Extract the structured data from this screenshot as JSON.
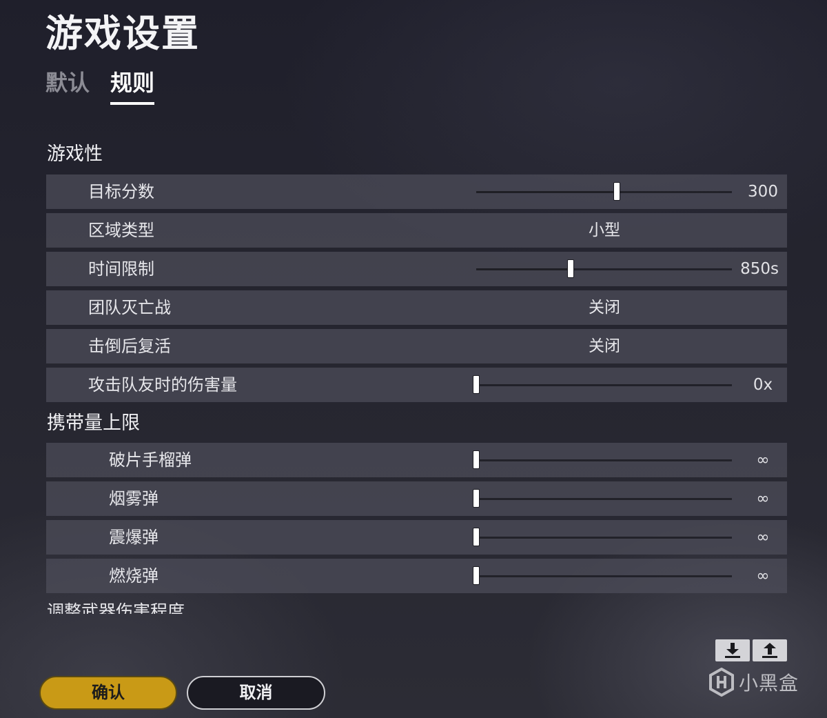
{
  "page": {
    "title": "游戏设置"
  },
  "tabs": [
    {
      "label": "默认",
      "active": false
    },
    {
      "label": "规则",
      "active": true
    }
  ],
  "gameplay": {
    "title": "游戏性",
    "rows": [
      {
        "label": "目标分数",
        "type": "slider",
        "fraction": 0.55,
        "value": "300"
      },
      {
        "label": "区域类型",
        "type": "select",
        "value": "小型"
      },
      {
        "label": "时间限制",
        "type": "slider",
        "fraction": 0.37,
        "value": "850s"
      },
      {
        "label": "团队灭亡战",
        "type": "select",
        "value": "关闭"
      },
      {
        "label": "击倒后复活",
        "type": "select",
        "value": "关闭"
      },
      {
        "label": "攻击队友时的伤害量",
        "type": "slider",
        "fraction": 0.0,
        "value": "0x"
      }
    ]
  },
  "carry_limit": {
    "title": "携带量上限",
    "rows": [
      {
        "label": "破片手榴弹",
        "type": "slider",
        "fraction": 0.0,
        "value": "∞"
      },
      {
        "label": "烟雾弹",
        "type": "slider",
        "fraction": 0.0,
        "value": "∞"
      },
      {
        "label": "震爆弹",
        "type": "slider",
        "fraction": 0.0,
        "value": "∞"
      },
      {
        "label": "燃烧弹",
        "type": "slider",
        "fraction": 0.0,
        "value": "∞"
      }
    ]
  },
  "weapon_damage": {
    "title": "调整武器伤害程度"
  },
  "io_buttons": {
    "import_icon": "download-icon",
    "export_icon": "upload-icon"
  },
  "footer": {
    "confirm_label": "确认",
    "cancel_label": "取消"
  },
  "watermark": {
    "text": "小黑盒"
  },
  "colors": {
    "confirm_bg": "#c99a16",
    "row_bg": "#4e4e5a",
    "accent_white": "#ffffff"
  }
}
